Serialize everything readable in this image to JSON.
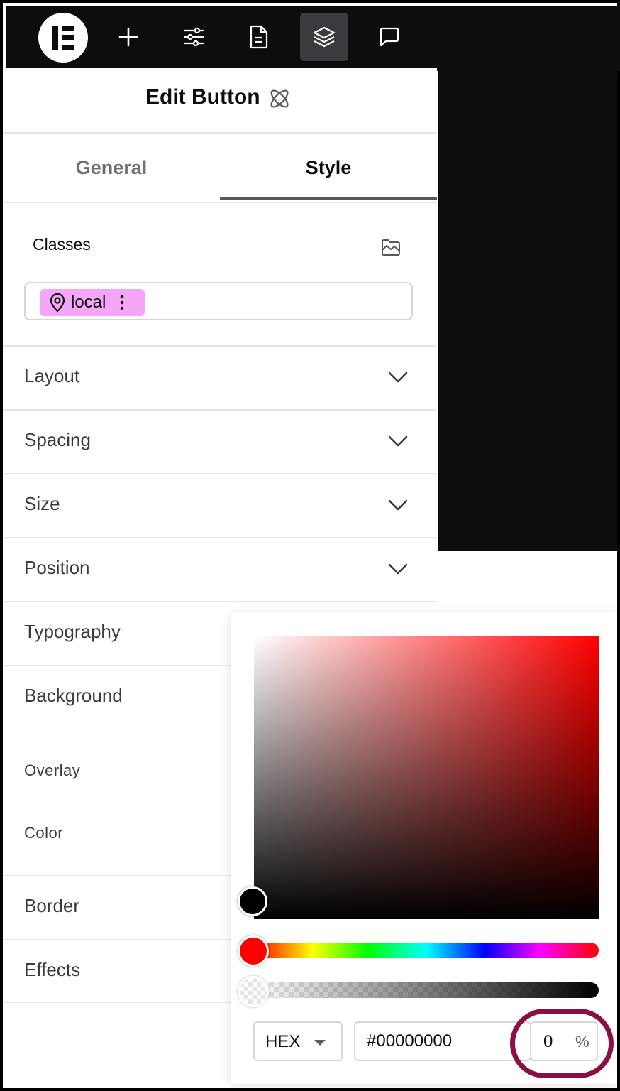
{
  "topbar": {
    "icons": [
      "elementor-logo-icon",
      "add-icon",
      "settings-sliders-icon",
      "document-icon",
      "layers-icon",
      "comments-icon"
    ]
  },
  "panel": {
    "title": "Edit Button",
    "title_icon": "atomic-icon",
    "tabs": [
      {
        "label": "General"
      },
      {
        "label": "Style"
      }
    ],
    "active_tab": "Style",
    "classes": {
      "label": "Classes",
      "chip": "local"
    },
    "sections": [
      {
        "label": "Layout"
      },
      {
        "label": "Spacing"
      },
      {
        "label": "Size"
      },
      {
        "label": "Position"
      },
      {
        "label": "Typography"
      },
      {
        "label": "Background"
      },
      {
        "label": "Border"
      },
      {
        "label": "Effects"
      }
    ],
    "background": {
      "overlay_label": "Overlay",
      "color_label": "Color"
    }
  },
  "color_picker": {
    "format": "HEX",
    "hex_value": "#00000000",
    "alpha_value": "0",
    "alpha_unit": "%",
    "hue_color": "#ff0000",
    "selected_color": "#000000",
    "alpha": 0
  },
  "colors": {
    "dark": "#0c0d0f",
    "chip": "#f5a6f8",
    "highlight": "#8a0f45"
  }
}
